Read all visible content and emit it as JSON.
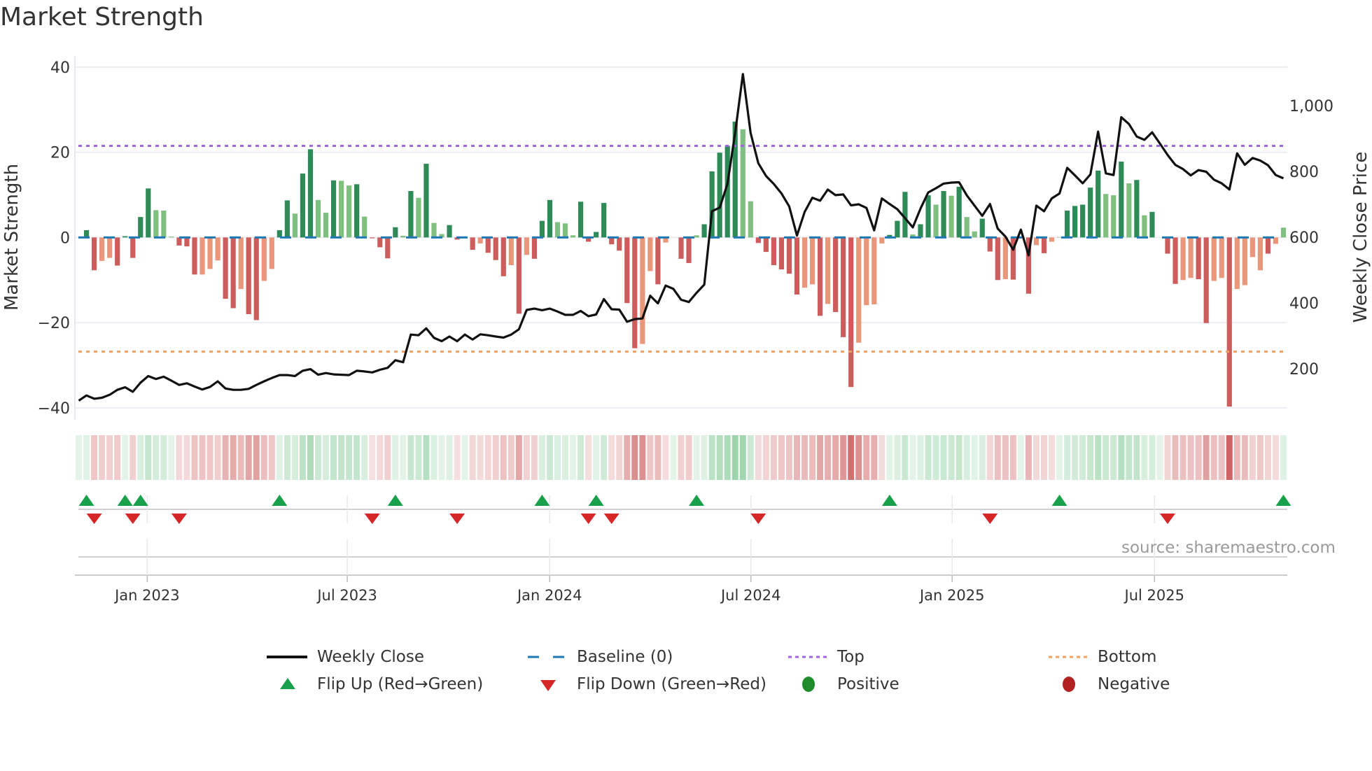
{
  "chart_data": {
    "type": "bar",
    "title": "Market Strength",
    "ylabel": "Market Strength",
    "y2label": "Weekly Close Price",
    "ylim": [
      -42.8,
      42.6
    ],
    "y2lim": [
      45,
      1151
    ],
    "xlim_weeks": [
      -0.5,
      156.5
    ],
    "y_ticks": [
      {
        "v": 40,
        "label": "40"
      },
      {
        "v": 20,
        "label": "20"
      },
      {
        "v": 0,
        "label": "0"
      },
      {
        "v": -20,
        "label": "−20"
      },
      {
        "v": -40,
        "label": "−40"
      }
    ],
    "y2_ticks": [
      {
        "v": 1000,
        "label": "1,000"
      },
      {
        "v": 800,
        "label": "800"
      },
      {
        "v": 600,
        "label": "600"
      },
      {
        "v": 400,
        "label": "400"
      },
      {
        "v": 200,
        "label": "200"
      }
    ],
    "x_ticks": [
      {
        "week": 8.87,
        "label": "Jan 2023"
      },
      {
        "week": 34.77,
        "label": "Jul 2023"
      },
      {
        "week": 60.98,
        "label": "Jan 2024"
      },
      {
        "week": 87.04,
        "label": "Jul 2024"
      },
      {
        "week": 113.1,
        "label": "Jan 2025"
      },
      {
        "week": 139.3,
        "label": "Jul 2025"
      }
    ],
    "top_level": 21.5,
    "bottom_level": -26.8,
    "baseline": 0,
    "strength": [
      0,
      1.7,
      -7.7,
      -5.5,
      -4.8,
      -6.6,
      0.3,
      -4.8,
      4.8,
      11.5,
      6.4,
      6.3,
      0.2,
      -1.9,
      -2.1,
      -8.7,
      -8.7,
      -7.4,
      -5.4,
      -14.4,
      -16.6,
      -12.1,
      -18,
      -19.4,
      -10.2,
      -7.4,
      1.7,
      8.7,
      5.6,
      15,
      20.7,
      8.8,
      5.8,
      13.4,
      13.3,
      12.2,
      12.5,
      4.9,
      -0.2,
      -2.3,
      -4.9,
      2.4,
      0.4,
      10.9,
      9.3,
      17.3,
      3.4,
      0.8,
      2.9,
      -0.5,
      0,
      -2.9,
      -1.4,
      -3.6,
      -5.3,
      -9.1,
      -6.5,
      -17.9,
      -4.1,
      -5.0,
      3.9,
      8.8,
      3.6,
      3.3,
      0.5,
      8.4,
      -1.0,
      1.3,
      8.1,
      -1.6,
      -3.1,
      -15.4,
      -26,
      -25,
      -7.9,
      -11,
      -1.2,
      0,
      -5.0,
      -6.0,
      0.5,
      3.1,
      15.5,
      19.9,
      21.5,
      27.2,
      25.4,
      8.5,
      -1.3,
      -3.4,
      -6.5,
      -7.5,
      -8.5,
      -13.4,
      -11.8,
      -11.0,
      -18.4,
      -15.6,
      -17.5,
      -23.4,
      -35.1,
      -24.7,
      -15.9,
      -15.7,
      -1.4,
      0.6,
      3.9,
      10.7,
      0.7,
      3.1,
      9.9,
      7.7,
      10.9,
      9.8,
      11.9,
      4.8,
      1.4,
      4.4,
      -3.3,
      -10,
      -9.8,
      -9.9,
      0,
      -13.2,
      -1.8,
      -3.7,
      -1.0,
      0.1,
      6.3,
      7.4,
      7.7,
      11.7,
      15.7,
      10.2,
      9.9,
      17.8,
      12.7,
      13.5,
      5.2,
      6.0,
      0,
      -3.8,
      -10.9,
      -10,
      -9.5,
      -9.8,
      -20.1,
      -10.2,
      -9.5,
      -39.7,
      -12.1,
      -11.2,
      -4.6,
      -7.7,
      -3.8,
      -1.5,
      2.3
    ],
    "strength_shade": "dddlldddddllldddllldd lddllddlddlldlldlddddldldllddddldddldlddd llldddddd ddlldldddldddddllddddddlldlddd lllldddlddldldlldddldddldllddd ddlldldlddddllddlldlllldlld",
    "weekly_close": [
      103,
      119,
      109,
      112,
      121,
      136,
      144,
      130,
      158,
      178,
      169,
      176,
      164,
      151,
      156,
      146,
      137,
      145,
      162,
      140,
      136,
      136,
      139,
      151,
      162,
      172,
      181,
      181,
      178,
      194,
      199,
      182,
      187,
      183,
      182,
      181,
      194,
      192,
      189,
      197,
      203,
      226,
      220,
      304,
      302,
      323,
      294,
      284,
      298,
      284,
      304,
      289,
      305,
      302,
      298,
      295,
      304,
      320,
      379,
      383,
      378,
      383,
      374,
      364,
      364,
      376,
      360,
      365,
      412,
      381,
      380,
      343,
      351,
      353,
      422,
      399,
      453,
      443,
      410,
      403,
      431,
      456,
      679,
      690,
      762,
      917,
      1096,
      917,
      825,
      786,
      762,
      733,
      694,
      605,
      677,
      720,
      711,
      745,
      728,
      730,
      697,
      700,
      689,
      621,
      718,
      701,
      685,
      658,
      630,
      687,
      736,
      749,
      763,
      766,
      767,
      727,
      696,
      665,
      701,
      626,
      602,
      562,
      623,
      545,
      696,
      679,
      718,
      733,
      811,
      788,
      764,
      791,
      921,
      794,
      789,
      965,
      944,
      906,
      896,
      919,
      885,
      850,
      820,
      807,
      788,
      804,
      799,
      775,
      764,
      745,
      855,
      820,
      841,
      833,
      819,
      789,
      779
    ],
    "flip_up": [
      1,
      6,
      8,
      26,
      41,
      60,
      67,
      80,
      105,
      127,
      156
    ],
    "flip_down": [
      2,
      7,
      13,
      38,
      49,
      66,
      69,
      88,
      118,
      141
    ],
    "legend": [
      {
        "key": "weekly_close",
        "label": "Weekly Close"
      },
      {
        "key": "baseline",
        "label": "Baseline (0)"
      },
      {
        "key": "top",
        "label": "Top"
      },
      {
        "key": "bottom",
        "label": "Bottom"
      },
      {
        "key": "flip_up",
        "label": "Flip Up (Red→Green)"
      },
      {
        "key": "flip_down",
        "label": "Flip Down (Green→Red)"
      },
      {
        "key": "positive",
        "label": "Positive"
      },
      {
        "key": "negative",
        "label": "Negative"
      }
    ],
    "legend_placement": "bottom",
    "source": "source: sharemaestro.com",
    "colors": {
      "pos_dark": "#2e8b57",
      "pos_light": "#7fbf7f",
      "neg_dark": "#cd5c5c",
      "neg_light": "#e9967a",
      "line": "#111111",
      "baseline": "#1f77b4",
      "top": "#a066e0",
      "bottom": "#f0a060",
      "flip_up": "#18a04a",
      "flip_down": "#d62728",
      "positive": "#1e8c2a",
      "negative": "#b22222"
    }
  }
}
